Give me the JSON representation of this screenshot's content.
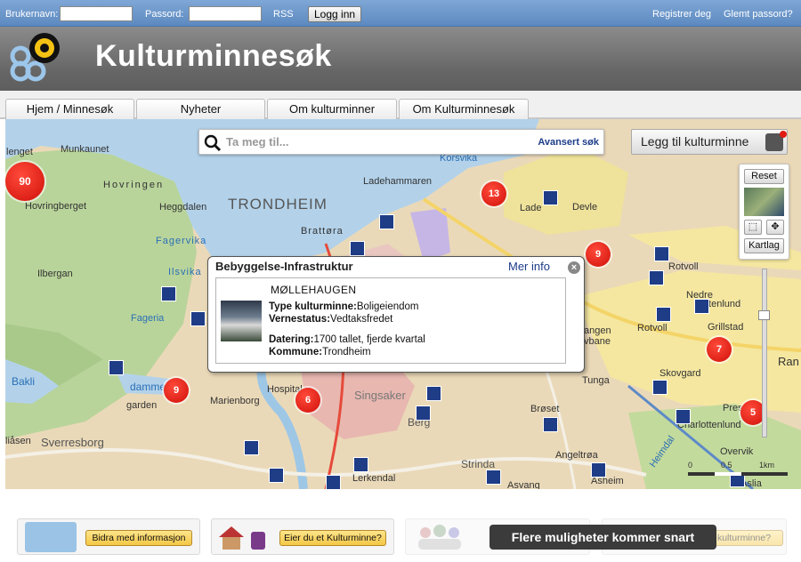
{
  "topbar": {
    "username_label": "Brukernavn:",
    "username_value": "",
    "password_label": "Passord:",
    "password_value": "",
    "rss": "RSS",
    "login_button": "Logg inn",
    "register": "Registrer deg",
    "forgot": "Glemt passord?"
  },
  "header": {
    "title": "Kulturminnesøk"
  },
  "tabs": [
    "Hjem / Minnesøk",
    "Nyheter",
    "Om kulturminner",
    "Om Kulturminnesøk"
  ],
  "search": {
    "placeholder": "Ta meg til...",
    "advanced": "Avansert søk"
  },
  "add_button": "Legg til kulturminne",
  "map_controls": {
    "reset": "Reset",
    "layers": "Kartlag"
  },
  "scale": {
    "zero": "0",
    "mid": "0.5",
    "unit": "1km"
  },
  "clusters": [
    "90",
    "13",
    "9",
    "9",
    "6",
    "7",
    "5"
  ],
  "map_labels": {
    "trondheim": "TRONDHEIM",
    "munkaunet": "Munkaunet",
    "lenget": "lenget",
    "hovringen": "Hovringen",
    "hovringberget": "Hovringberget",
    "heggdalen": "Heggdalen",
    "fagervika": "Fagervika",
    "ilsvika": "Ilsvika",
    "ilbergan": "Ilbergan",
    "fageria": "Fageria",
    "brattora": "Brattøra",
    "korsvika": "Korsvika",
    "ladehammaren": "Ladehammaren",
    "lade": "Lade",
    "devle": "Devle",
    "rotvoll": "Rotvoll",
    "rotvoll2": "Rotvoll",
    "grillstad": "Grillstad",
    "skovgard": "Skovgard",
    "charlottenlund": "Charlottenlund",
    "overvik": "Overvik",
    "tunga": "Tunga",
    "bakli": "Bakli",
    "dammen": "dammen",
    "garden": "garden",
    "hospital": "Hospital",
    "marienborg": "Marienborg",
    "singsaker": "Singsaker",
    "berg": "Berg",
    "alliaasen": "liåsen",
    "sverresborg": "Sverresborg",
    "stringa": "Strinda",
    "lerkendal": "Lerkendal",
    "asvang": "Asvang",
    "angeltrona": "Angeltrøa",
    "asheim": "Asheim",
    "broset": "Brøset",
    "ranheim": "Ran",
    "presten": "Pres",
    "nedre": "Nedre",
    "ottenlund": "ttenlund",
    "vbane": "vbane",
    "angen": "angen",
    "heimdal": "Heimdal",
    "aslia": "Aslia"
  },
  "popup": {
    "title": "Bebyggelse-Infrastruktur",
    "more": "Mer info",
    "name": "MØLLEHAUGEN",
    "type_label": "Type kulturminne:",
    "type_value": "Boligeiendom",
    "status_label": "Vernestatus:",
    "status_value": "Vedtaksfredet",
    "date_label": "Datering:",
    "date_value": "1700 tallet, fjerde kvartal",
    "municipality_label": "Kommune:",
    "municipality_value": "Trondheim"
  },
  "footer": {
    "contribute": "Bidra med informasjon",
    "owner": "Eier du et Kulturminne?",
    "owner_faded": "kulturminne?",
    "coming_soon": "Flere muligheter kommer snart"
  },
  "colors": {
    "topbar": "#6b96cb",
    "header": "#6e6e6e",
    "cluster": "#e11b12",
    "poi": "#1f3c86",
    "water": "#b3d2ea",
    "land": "#ead9b8",
    "urban": "#e8b7b0",
    "forest": "#b7d39a"
  }
}
